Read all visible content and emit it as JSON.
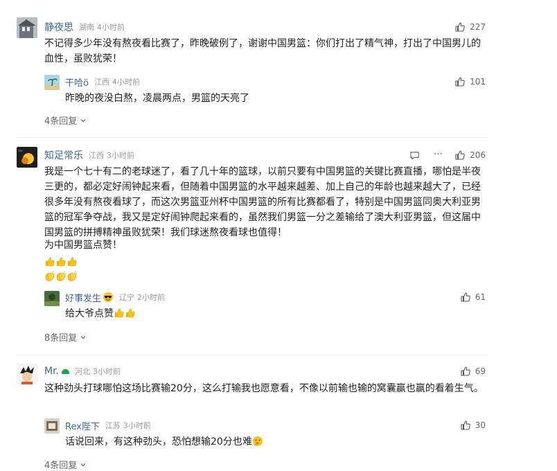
{
  "comments": [
    {
      "user": "静夜思",
      "location": "湖南",
      "time": "4小时前",
      "likes": "227",
      "text": "不记得多少年没有熬夜看比赛了，昨晚破例了，谢谢中国男篮：你们打出了精气神，打出了中国男儿的血性，虽败犹荣！",
      "reply": {
        "user": "干哈ö",
        "location": "江西",
        "time": "4小时前",
        "likes": "101",
        "text": "昨晚的夜没白熬，凌晨两点，男篮的天亮了"
      },
      "more_replies": "4条回复"
    },
    {
      "user": "知足常乐",
      "location": "江西",
      "time": "3小时前",
      "likes": "206",
      "text": "我是一个七十有二的老球迷了，看了几十年的篮球，以前只要有中国男篮的关键比赛直播，哪怕是半夜三更的，都必定好闹钟起来看，但随着中国男篮的水平越来越差、加上自己的年龄也越来越大了，已经很多年没有熬夜看球了，而这次男篮亚州杯中国男篮的所有比赛都看了，特别是中国男篮同奥大利亚男篮的冠军争夺战，我又是定好闹钟爬起来看的，虽然我们男篮一分之差输给了澳大利亚男篮，但这届中国男篮的拼搏精神虽败犹荣！我们球迷熬夜看球也值得！",
      "text2": "为中国男篮点赞！",
      "reply": {
        "user": "好事发生",
        "location": "辽宁",
        "time": "2小时前",
        "likes": "61",
        "text": "给大爷点赞"
      },
      "more_replies": "8条回复"
    },
    {
      "user": "Mr.",
      "location": "河北",
      "time": "3小时前",
      "likes": "69",
      "text": "这种劲头打球哪怕这场比赛输20分，这么打输我也愿意看，不像以前输也输的窝囊赢也赢的看着生气。",
      "reply": {
        "user": "Rex陛下",
        "location": "江苏",
        "time": "3小时前",
        "likes": "30",
        "text": "话说回来，有这种劲头，恐怕想输20分也难"
      },
      "more_replies": "4条回复"
    }
  ],
  "colors": {
    "name": "#406599",
    "meta": "#999999",
    "text": "#222222",
    "more": "#666666",
    "badge_green": "#1aa64a"
  },
  "icons": {
    "like": "thumb-up-icon",
    "reply": "comment-icon",
    "more": "ellipsis-icon",
    "expand": "chevron-down-icon",
    "emoji_thumb": "thumbs-up-emoji",
    "emoji_clap": "clap-emoji",
    "emoji_think": "thinking-emoji",
    "emoji_cool": "sunglasses-emoji"
  }
}
